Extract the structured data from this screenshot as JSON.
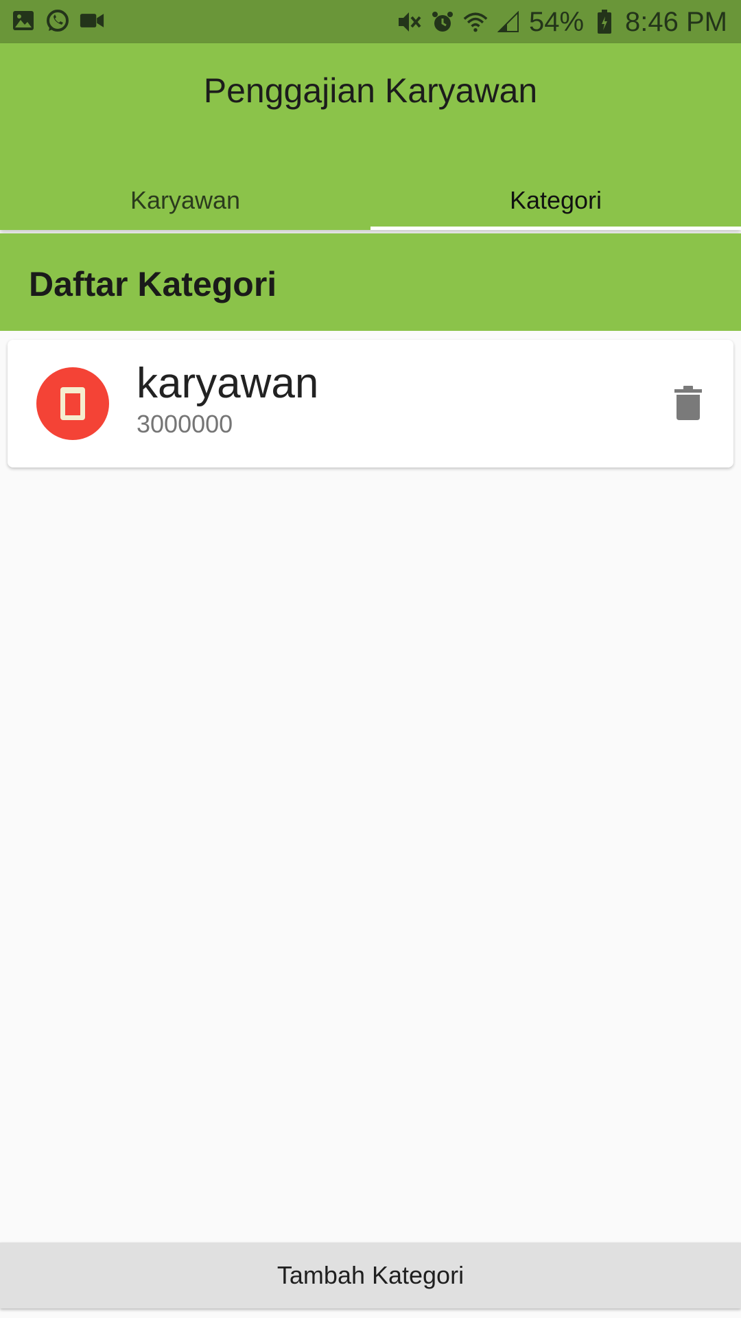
{
  "status_bar": {
    "left_icons": [
      "image-icon",
      "whatsapp-icon",
      "video-camera-icon"
    ],
    "right_icons": [
      "vibrate-mute-icon",
      "alarm-icon",
      "wifi-icon",
      "signal-icon",
      "battery-icon"
    ],
    "battery": "54%",
    "time": "8:46 PM"
  },
  "app_bar": {
    "title": "Penggajian Karyawan",
    "color": "#8bc34a"
  },
  "tabs": [
    {
      "label": "Karyawan",
      "active": false
    },
    {
      "label": "Kategori",
      "active": true
    }
  ],
  "section": {
    "title": "Daftar Kategori"
  },
  "categories": [
    {
      "name": "karyawan",
      "amount": "3000000",
      "icon": "card-icon",
      "icon_color": "#f44336"
    }
  ],
  "actions": {
    "add_label": "Tambah Kategori"
  }
}
